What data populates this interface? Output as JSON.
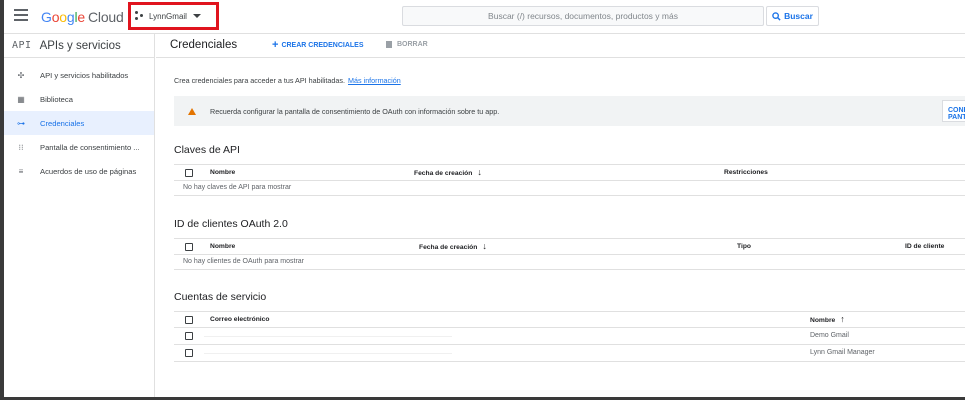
{
  "topbar": {
    "logo_letters": [
      "G",
      "o",
      "o",
      "g",
      "l",
      "e"
    ],
    "logo_cloud": "Cloud",
    "project_name": "LynnGmail",
    "search_placeholder": "Buscar (/) recursos, documentos, productos y más",
    "search_button": "Buscar"
  },
  "sidebar": {
    "api_mark": "API",
    "title": "APIs y servicios",
    "items": [
      {
        "label": "API y servicios habilitados",
        "icon": "hub-icon",
        "glyph": "✣",
        "active": false
      },
      {
        "label": "Biblioteca",
        "icon": "library-grid-icon",
        "glyph": "▦",
        "active": false
      },
      {
        "label": "Credenciales",
        "icon": "key-icon",
        "glyph": "⊶",
        "active": true
      },
      {
        "label": "Pantalla de consentimiento ...",
        "icon": "consent-icon",
        "glyph": "⁝⁝",
        "active": false
      },
      {
        "label": "Acuerdos de uso de páginas",
        "icon": "settings-list-icon",
        "glyph": "≡",
        "active": false
      }
    ]
  },
  "main": {
    "title": "Credenciales",
    "create_button": "CREAR CREDENCIALES",
    "delete_button": "BORRAR",
    "intro_text": "Crea credenciales para acceder a tus API habilitadas.",
    "intro_link": "Más información",
    "warning_text": "Recuerda configurar la pantalla de consentimiento de OAuth con información sobre tu app.",
    "warning_action": "CONFIGURAR PANTALLA DE CONSENTIMIENTO"
  },
  "api_keys": {
    "title": "Claves de API",
    "columns": [
      "Nombre",
      "Fecha de creación",
      "Restricciones"
    ],
    "empty": "No hay claves de API para mostrar"
  },
  "oauth": {
    "title": "ID de clientes OAuth 2.0",
    "columns": [
      "Nombre",
      "Fecha de creación",
      "Tipo",
      "ID de cliente"
    ],
    "empty": "No hay clientes de OAuth para mostrar"
  },
  "service_accounts": {
    "title": "Cuentas de servicio",
    "columns": [
      "Correo electrónico",
      "Nombre"
    ],
    "rows": [
      {
        "email": "",
        "name": "Demo Gmail"
      },
      {
        "email": "",
        "name": "Lynn Gmail Manager"
      }
    ]
  },
  "colors": {
    "accent": "#1a73e8",
    "highlight_box": "#e0141e",
    "warning": "#e37400"
  }
}
